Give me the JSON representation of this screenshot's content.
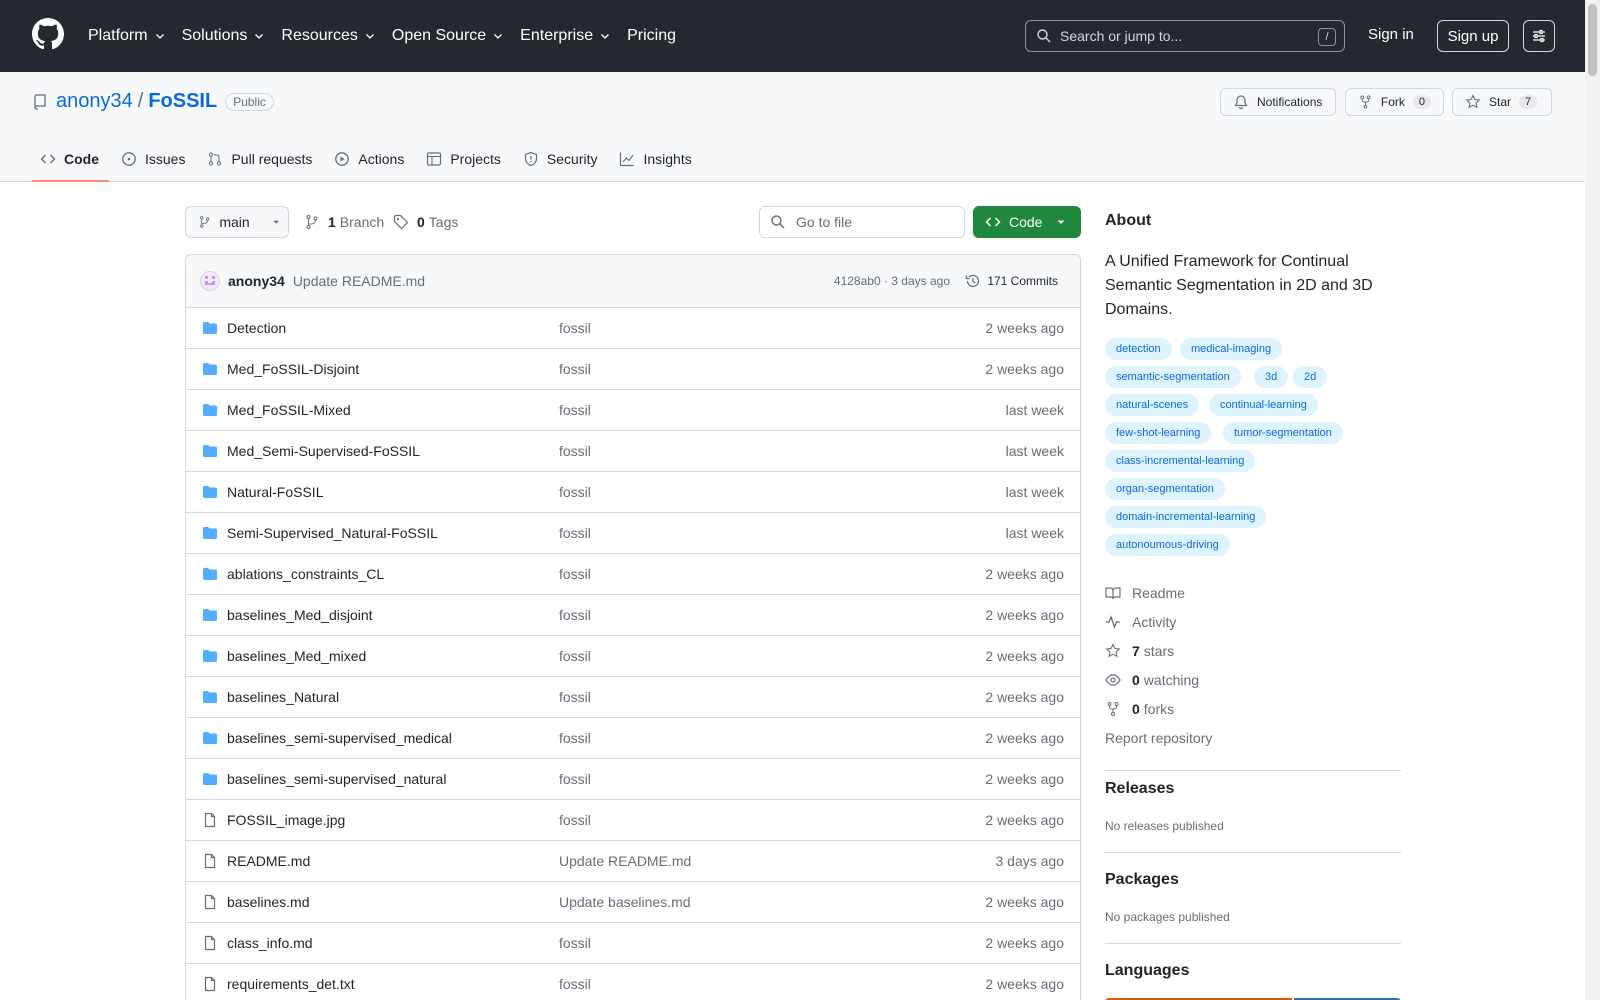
{
  "topbar": {
    "nav": [
      "Platform",
      "Solutions",
      "Resources",
      "Open Source",
      "Enterprise",
      "Pricing"
    ],
    "search_placeholder": "Search or jump to...",
    "search_hint": "/",
    "signin": "Sign in",
    "signup": "Sign up"
  },
  "repo": {
    "owner": "anony34",
    "separator": "/",
    "name": "FoSSIL",
    "visibility": "Public",
    "notifications_label": "Notifications",
    "fork_label": "Fork",
    "fork_count": "0",
    "star_label": "Star",
    "star_count": "7",
    "tabs": [
      "Code",
      "Issues",
      "Pull requests",
      "Actions",
      "Projects",
      "Security",
      "Insights"
    ]
  },
  "toolbar": {
    "branch": "main",
    "branch_count": "1",
    "branch_label": "Branch",
    "tag_count": "0",
    "tag_label": "Tags",
    "goto_placeholder": "Go to file",
    "code_label": "Code"
  },
  "commit": {
    "author": "anony34",
    "message": "Update README.md",
    "meta": "4128ab0 · 3 days ago",
    "commits": "171 Commits"
  },
  "files": [
    {
      "name": "Detection",
      "type": "dir",
      "commit": "fossil",
      "age": "2 weeks ago"
    },
    {
      "name": "Med_FoSSIL-Disjoint",
      "type": "dir",
      "commit": "fossil",
      "age": "2 weeks ago"
    },
    {
      "name": "Med_FoSSIL-Mixed",
      "type": "dir",
      "commit": "fossil",
      "age": "last week"
    },
    {
      "name": "Med_Semi-Supervised-FoSSIL",
      "type": "dir",
      "commit": "fossil",
      "age": "last week"
    },
    {
      "name": "Natural-FoSSIL",
      "type": "dir",
      "commit": "fossil",
      "age": "last week"
    },
    {
      "name": "Semi-Supervised_Natural-FoSSIL",
      "type": "dir",
      "commit": "fossil",
      "age": "last week"
    },
    {
      "name": "ablations_constraints_CL",
      "type": "dir",
      "commit": "fossil",
      "age": "2 weeks ago"
    },
    {
      "name": "baselines_Med_disjoint",
      "type": "dir",
      "commit": "fossil",
      "age": "2 weeks ago"
    },
    {
      "name": "baselines_Med_mixed",
      "type": "dir",
      "commit": "fossil",
      "age": "2 weeks ago"
    },
    {
      "name": "baselines_Natural",
      "type": "dir",
      "commit": "fossil",
      "age": "2 weeks ago"
    },
    {
      "name": "baselines_semi-supervised_medical",
      "type": "dir",
      "commit": "fossil",
      "age": "2 weeks ago"
    },
    {
      "name": "baselines_semi-supervised_natural",
      "type": "dir",
      "commit": "fossil",
      "age": "2 weeks ago"
    },
    {
      "name": "FOSSIL_image.jpg",
      "type": "file",
      "commit": "fossil",
      "age": "2 weeks ago"
    },
    {
      "name": "README.md",
      "type": "file",
      "commit": "Update README.md",
      "age": "3 days ago"
    },
    {
      "name": "baselines.md",
      "type": "file",
      "commit": "Update baselines.md",
      "age": "2 weeks ago"
    },
    {
      "name": "class_info.md",
      "type": "file",
      "commit": "fossil",
      "age": "2 weeks ago"
    },
    {
      "name": "requirements_det.txt",
      "type": "file",
      "commit": "fossil",
      "age": "2 weeks ago"
    }
  ],
  "about": {
    "title": "About",
    "description": "A Unified Framework for Continual Semantic Segmentation in 2D and 3D Domains.",
    "topics": [
      "detection",
      "medical-imaging",
      "semantic-segmentation",
      "3d",
      "2d",
      "natural-scenes",
      "continual-learning",
      "few-shot-learning",
      "tumor-segmentation",
      "class-incremental-learning",
      "organ-segmentation",
      "domain-incremental-learning",
      "autonoumous-driving"
    ],
    "readme": "Readme",
    "activity": "Activity",
    "stars_count": "7",
    "stars_label": "stars",
    "watching_count": "0",
    "watching_label": "watching",
    "forks_count": "0",
    "forks_label": "forks",
    "report": "Report repository"
  },
  "releases": {
    "title": "Releases",
    "note": "No releases published"
  },
  "packages": {
    "title": "Packages",
    "note": "No packages published"
  },
  "languages": {
    "title": "Languages",
    "colors": [
      "#DA5B0B",
      "#3572A5"
    ]
  },
  "colors": {
    "accent": "#0969da",
    "header_bg": "#24292f",
    "code_button": "#1f883d",
    "active_tab": "#fd8c73",
    "folder": "#54aeff"
  }
}
